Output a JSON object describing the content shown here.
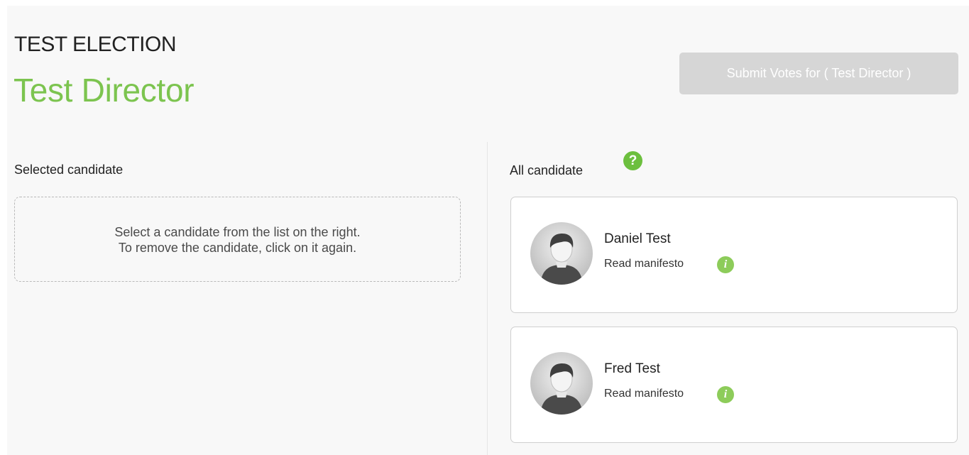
{
  "header": {
    "election_title": "TEST ELECTION",
    "position_title": "Test Director",
    "submit_label": "Submit Votes for ( Test Director )"
  },
  "selected": {
    "label": "Selected candidate",
    "instructions_line1": "Select a candidate from the list on the right.",
    "instructions_line2": "To remove the candidate, click on it again."
  },
  "all": {
    "label": "All candidate",
    "help_icon": "question-mark-icon",
    "candidates": [
      {
        "name": "Daniel Test",
        "manifesto_label": "Read manifesto",
        "avatar_icon": "user-avatar-icon",
        "info_icon": "info-icon"
      },
      {
        "name": "Fred Test",
        "manifesto_label": "Read manifesto",
        "avatar_icon": "user-avatar-icon",
        "info_icon": "info-icon"
      }
    ]
  },
  "colors": {
    "accent_green": "#7cc44f",
    "help_green": "#6cbf3e",
    "info_green": "#8dcc5a",
    "disabled_button": "#d6d6d6"
  }
}
